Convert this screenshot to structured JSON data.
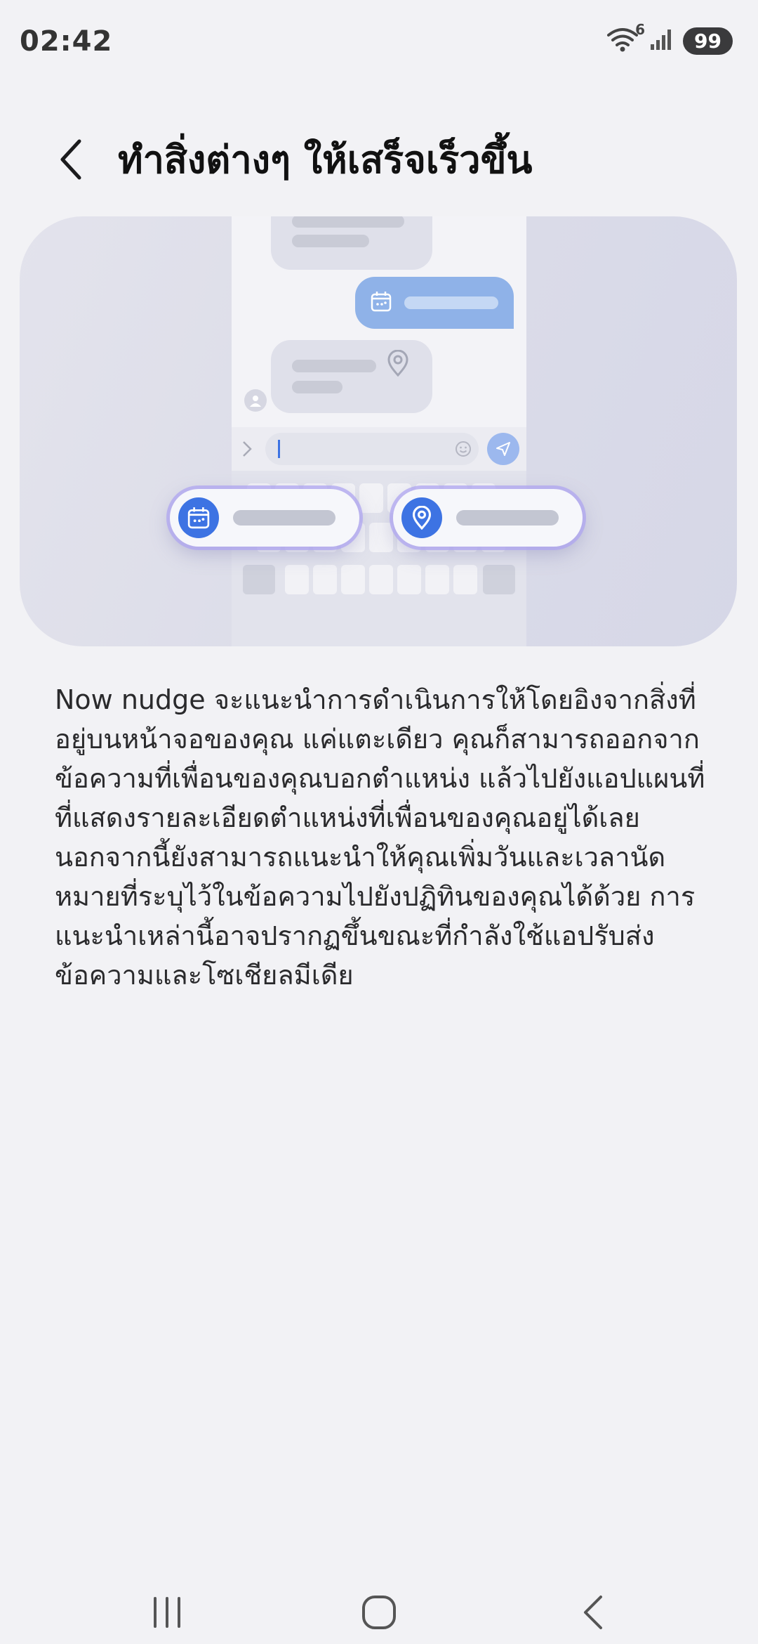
{
  "status_bar": {
    "time": "02:42",
    "wifi_badge": "6",
    "battery": "99",
    "icons": [
      "wifi-icon",
      "signal-icon",
      "battery-icon"
    ]
  },
  "header": {
    "back_icon": "chevron-left-icon",
    "title": "ทำสิ่งต่างๆ ให้เสร็จเร็วขึ้น"
  },
  "illustration": {
    "icons": [
      "calendar-icon",
      "location-pin-icon",
      "send-icon",
      "emoji-icon",
      "profile-icon"
    ],
    "colors": {
      "accent": "#3d73e3",
      "bubble_out": "#8fb2e8",
      "bubble_in": "#dfe0ea"
    }
  },
  "description": "Now nudge จะแนะนำการดำเนินการให้โดยอิงจากสิ่งที่อยู่บนหน้าจอของคุณ แค่แตะเดียว คุณก็สามารถออกจากข้อความที่เพื่อนของคุณบอกตำแหน่ง แล้วไปยังแอปแผนที่ที่แสดงรายละเอียดตำแหน่งที่เพื่อนของคุณอยู่ได้เลย นอกจากนี้ยังสามารถแนะนำให้คุณเพิ่มวันและเวลานัดหมายที่ระบุไว้ในข้อความไปยังปฏิทินของคุณได้ด้วย การแนะนำเหล่านี้อาจปรากฏขึ้นขณะที่กำลังใช้แอปรับส่งข้อความและโซเชียลมีเดีย",
  "nav_bar": {
    "icons": [
      "recents-icon",
      "home-icon",
      "back-icon"
    ]
  }
}
